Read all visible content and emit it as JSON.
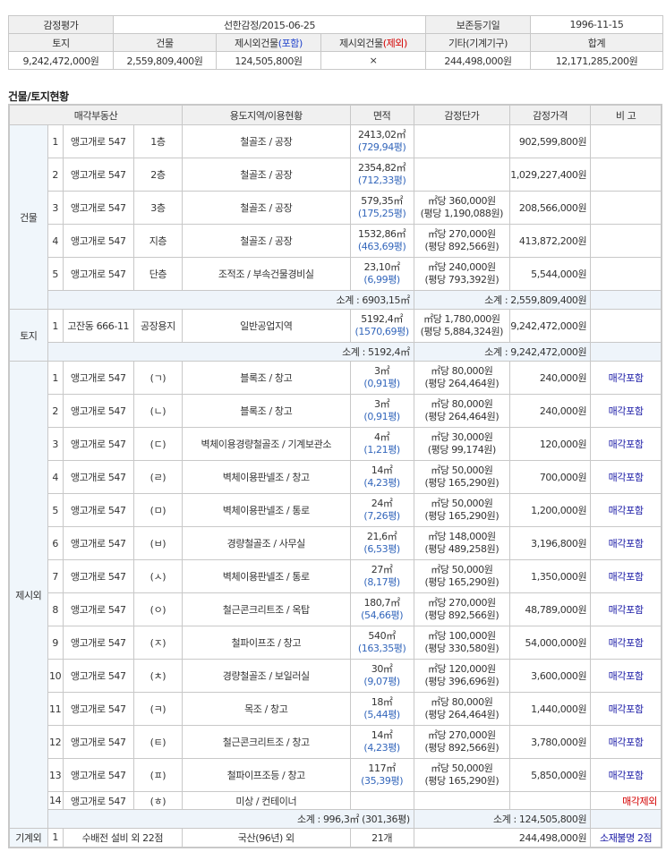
{
  "summary": {
    "appraisal_label": "감정평가",
    "appraisal_value": "선한감정/2015-06-25",
    "registry_label": "보존등기일",
    "registry_value": "1996-11-15",
    "headers": [
      "토지",
      "건물",
      "제시외건물",
      "(포함)",
      "제시외건물",
      "(제외)",
      "기타(기계기구)",
      "합계"
    ],
    "values": [
      "9,242,472,000원",
      "2,559,809,400원",
      "124,505,800원",
      "×",
      "244,498,000원",
      "12,171,285,200원"
    ]
  },
  "section_title": "건물/토지현황",
  "table": {
    "headers": [
      "매각부동산",
      "용도지역/이용현황",
      "면적",
      "감정단가",
      "감정가격",
      "비 고"
    ],
    "building": {
      "label": "건물",
      "rows": [
        {
          "no": "1",
          "addr": "앵고개로 547",
          "floor": "1층",
          "use": "철골조 / 공장",
          "area": "2413,02㎡",
          "area2": "(729,94평)",
          "unit1": "",
          "unit2": "",
          "price": "902,599,800원"
        },
        {
          "no": "2",
          "addr": "앵고개로 547",
          "floor": "2층",
          "use": "철골조 / 공장",
          "area": "2354,82㎡",
          "area2": "(712,33평)",
          "unit1": "",
          "unit2": "",
          "price": "1,029,227,400원"
        },
        {
          "no": "3",
          "addr": "앵고개로 547",
          "floor": "3층",
          "use": "철골조 / 공장",
          "area": "579,35㎡",
          "area2": "(175,25평)",
          "unit1": "㎡당 360,000원",
          "unit2": "(평당 1,190,088원)",
          "price": "208,566,000원"
        },
        {
          "no": "4",
          "addr": "앵고개로 547",
          "floor": "지층",
          "use": "철골조 / 공장",
          "area": "1532,86㎡",
          "area2": "(463,69평)",
          "unit1": "㎡당 270,000원",
          "unit2": "(평당 892,566원)",
          "price": "413,872,200원"
        },
        {
          "no": "5",
          "addr": "앵고개로 547",
          "floor": "단층",
          "use": "조적조 / 부속건물경비실",
          "area": "23,10㎡",
          "area2": "(6,99평)",
          "unit1": "㎡당 240,000원",
          "unit2": "(평당 793,392원)",
          "price": "5,544,000원"
        }
      ],
      "subtotal_area": "소계 : 6903,15㎡",
      "subtotal_price": "소계 : 2,559,809,400원"
    },
    "land": {
      "label": "토지",
      "rows": [
        {
          "no": "1",
          "addr": "고잔동 666-11",
          "floor": "공장용지",
          "use": "일반공업지역",
          "area": "5192,4㎡",
          "area2": "(1570,69평)",
          "unit1": "㎡당 1,780,000원",
          "unit2": "(평당 5,884,324원)",
          "price": "9,242,472,000원"
        }
      ],
      "subtotal_area": "소계 : 5192,4㎡",
      "subtotal_price": "소계 : 9,242,472,000원"
    },
    "extra": {
      "label": "제시외",
      "rows": [
        {
          "no": "1",
          "addr": "앵고개로 547",
          "floor": "(ㄱ)",
          "use": "블록조 / 창고",
          "area": "3㎡",
          "area2": "(0,91평)",
          "unit1": "㎡당 80,000원",
          "unit2": "(평당 264,464원)",
          "price": "240,000원",
          "note": "매각포함"
        },
        {
          "no": "2",
          "addr": "앵고개로 547",
          "floor": "(ㄴ)",
          "use": "블록조 / 창고",
          "area": "3㎡",
          "area2": "(0,91평)",
          "unit1": "㎡당 80,000원",
          "unit2": "(평당 264,464원)",
          "price": "240,000원",
          "note": "매각포함"
        },
        {
          "no": "3",
          "addr": "앵고개로 547",
          "floor": "(ㄷ)",
          "use": "벽체이용경량철골조 / 기계보관소",
          "area": "4㎡",
          "area2": "(1,21평)",
          "unit1": "㎡당 30,000원",
          "unit2": "(평당 99,174원)",
          "price": "120,000원",
          "note": "매각포함"
        },
        {
          "no": "4",
          "addr": "앵고개로 547",
          "floor": "(ㄹ)",
          "use": "벽체이용판넬조 / 창고",
          "area": "14㎡",
          "area2": "(4,23평)",
          "unit1": "㎡당 50,000원",
          "unit2": "(평당 165,290원)",
          "price": "700,000원",
          "note": "매각포함"
        },
        {
          "no": "5",
          "addr": "앵고개로 547",
          "floor": "(ㅁ)",
          "use": "벽체이용판넬조 / 통로",
          "area": "24㎡",
          "area2": "(7,26평)",
          "unit1": "㎡당 50,000원",
          "unit2": "(평당 165,290원)",
          "price": "1,200,000원",
          "note": "매각포함"
        },
        {
          "no": "6",
          "addr": "앵고개로 547",
          "floor": "(ㅂ)",
          "use": "경량철골조 / 사무실",
          "area": "21,6㎡",
          "area2": "(6,53평)",
          "unit1": "㎡당 148,000원",
          "unit2": "(평당 489,258원)",
          "price": "3,196,800원",
          "note": "매각포함"
        },
        {
          "no": "7",
          "addr": "앵고개로 547",
          "floor": "(ㅅ)",
          "use": "벽체이용판넬조 / 통로",
          "area": "27㎡",
          "area2": "(8,17평)",
          "unit1": "㎡당 50,000원",
          "unit2": "(평당 165,290원)",
          "price": "1,350,000원",
          "note": "매각포함"
        },
        {
          "no": "8",
          "addr": "앵고개로 547",
          "floor": "(ㅇ)",
          "use": "철근콘크리트조 / 옥탑",
          "area": "180,7㎡",
          "area2": "(54,66평)",
          "unit1": "㎡당 270,000원",
          "unit2": "(평당 892,566원)",
          "price": "48,789,000원",
          "note": "매각포함"
        },
        {
          "no": "9",
          "addr": "앵고개로 547",
          "floor": "(ㅈ)",
          "use": "철파이프조 / 창고",
          "area": "540㎡",
          "area2": "(163,35평)",
          "unit1": "㎡당 100,000원",
          "unit2": "(평당 330,580원)",
          "price": "54,000,000원",
          "note": "매각포함"
        },
        {
          "no": "10",
          "addr": "앵고개로 547",
          "floor": "(ㅊ)",
          "use": "경량철골조 / 보일러실",
          "area": "30㎡",
          "area2": "(9,07평)",
          "unit1": "㎡당 120,000원",
          "unit2": "(평당 396,696원)",
          "price": "3,600,000원",
          "note": "매각포함"
        },
        {
          "no": "11",
          "addr": "앵고개로 547",
          "floor": "(ㅋ)",
          "use": "목조 / 창고",
          "area": "18㎡",
          "area2": "(5,44평)",
          "unit1": "㎡당 80,000원",
          "unit2": "(평당 264,464원)",
          "price": "1,440,000원",
          "note": "매각포함"
        },
        {
          "no": "12",
          "addr": "앵고개로 547",
          "floor": "(ㅌ)",
          "use": "철근콘크리트조 / 창고",
          "area": "14㎡",
          "area2": "(4,23평)",
          "unit1": "㎡당 270,000원",
          "unit2": "(평당 892,566원)",
          "price": "3,780,000원",
          "note": "매각포함"
        },
        {
          "no": "13",
          "addr": "앵고개로 547",
          "floor": "(ㅍ)",
          "use": "철파이프조등 / 창고",
          "area": "117㎡",
          "area2": "(35,39평)",
          "unit1": "㎡당 50,000원",
          "unit2": "(평당 165,290원)",
          "price": "5,850,000원",
          "note": "매각포함"
        },
        {
          "no": "14",
          "addr": "앵고개로 547",
          "floor": "(ㅎ)",
          "use": "미상 / 컨테이너",
          "area": "",
          "area2": "",
          "unit1": "",
          "unit2": "",
          "price": "",
          "note": "매각제외"
        }
      ],
      "subtotal_area": "소계 : 996,3㎡ (301,36평)",
      "subtotal_price": "소계 : 124,505,800원"
    },
    "machine": {
      "label": "기계외",
      "no": "1",
      "name": "수배전 설비 외 22점",
      "use": "국산(96년) 외",
      "qty": "21개",
      "price": "244,498,000원",
      "note": "소재불명 2점"
    }
  }
}
